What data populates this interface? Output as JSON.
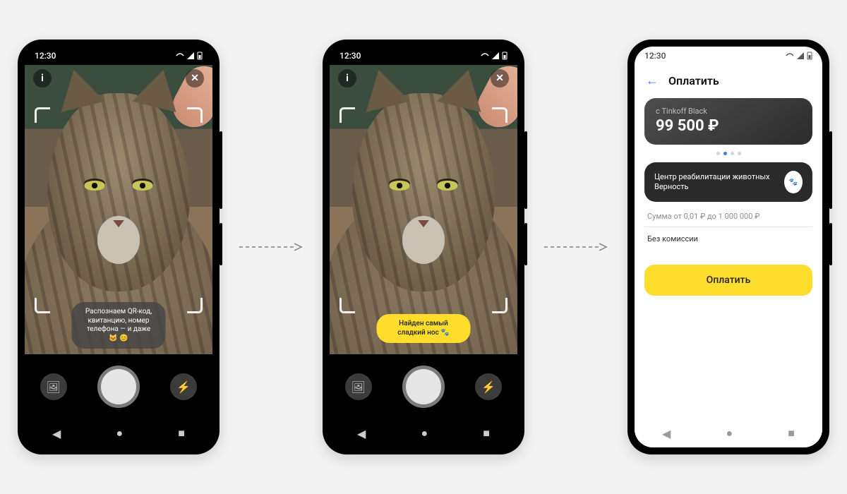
{
  "status": {
    "time": "12:30"
  },
  "phone1": {
    "info_icon": "i",
    "close_icon": "✕",
    "hint_text": "Распознаем QR-код, квитанцию, номер телефона — и даже 🐱 😊",
    "gallery_icon": "🖼",
    "flash_icon": "⚡"
  },
  "phone2": {
    "found_text": "Найден самый сладкий нос 🐾"
  },
  "phone3": {
    "header_title": "Оплатить",
    "card": {
      "subtitle": "с Tinkoff Black",
      "amount": "99 500 ₽"
    },
    "recipient": "Центр реабилитации животных Верность",
    "amount_hint": "Сумма от 0,01 ₽ до 1 000 000 ₽",
    "fee_text": "Без комиссии",
    "pay_button": "Оплатить"
  },
  "nav": {
    "back": "◀",
    "home": "●",
    "recent": "■"
  }
}
